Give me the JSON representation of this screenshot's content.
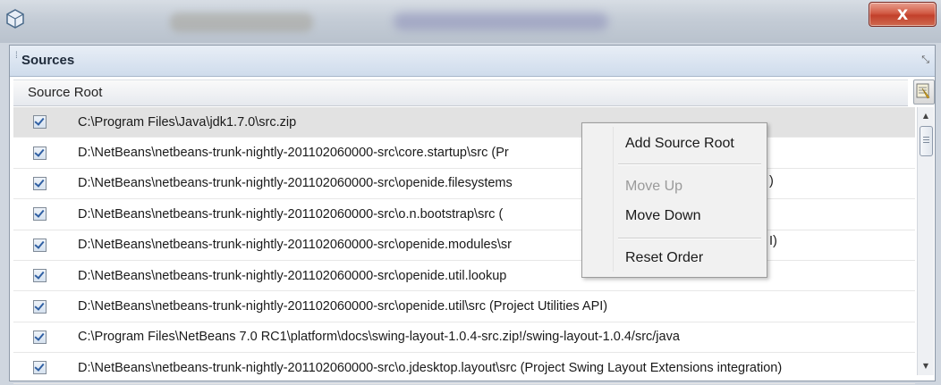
{
  "window": {
    "close_label": "X"
  },
  "panel": {
    "title": "Sources"
  },
  "table": {
    "column_header": "Source Root",
    "rows": [
      {
        "checked": true,
        "path": "C:\\Program Files\\Java\\jdk1.7.0\\src.zip"
      },
      {
        "checked": true,
        "path": "D:\\NetBeans\\netbeans-trunk-nightly-201102060000-src\\core.startup\\src (Pr"
      },
      {
        "checked": true,
        "path": "D:\\NetBeans\\netbeans-trunk-nightly-201102060000-src\\openide.filesystems"
      },
      {
        "checked": true,
        "path": "D:\\NetBeans\\netbeans-trunk-nightly-201102060000-src\\o.n.bootstrap\\src ("
      },
      {
        "checked": true,
        "path": "D:\\NetBeans\\netbeans-trunk-nightly-201102060000-src\\openide.modules\\sr"
      },
      {
        "checked": true,
        "path": "D:\\NetBeans\\netbeans-trunk-nightly-201102060000-src\\openide.util.lookup"
      },
      {
        "checked": true,
        "path": "D:\\NetBeans\\netbeans-trunk-nightly-201102060000-src\\openide.util\\src (Project Utilities API)"
      },
      {
        "checked": true,
        "path": "C:\\Program Files\\NetBeans 7.0 RC1\\platform\\docs\\swing-layout-1.0.4-src.zip!/swing-layout-1.0.4/src/java"
      },
      {
        "checked": true,
        "path": "D:\\NetBeans\\netbeans-trunk-nightly-201102060000-src\\o.jdesktop.layout\\src (Project Swing Layout Extensions integration)"
      }
    ]
  },
  "context_menu": {
    "add_source_root": "Add Source Root",
    "move_up": "Move Up",
    "move_down": "Move Down",
    "reset_order": "Reset Order",
    "overflow_row5": ")",
    "overflow_row6": "I)"
  },
  "icons": {
    "app": "netbeans-cube-icon",
    "maximize": "maximize-icon",
    "corner": "column-chooser-icon",
    "checkbox": "checkmark-icon"
  }
}
